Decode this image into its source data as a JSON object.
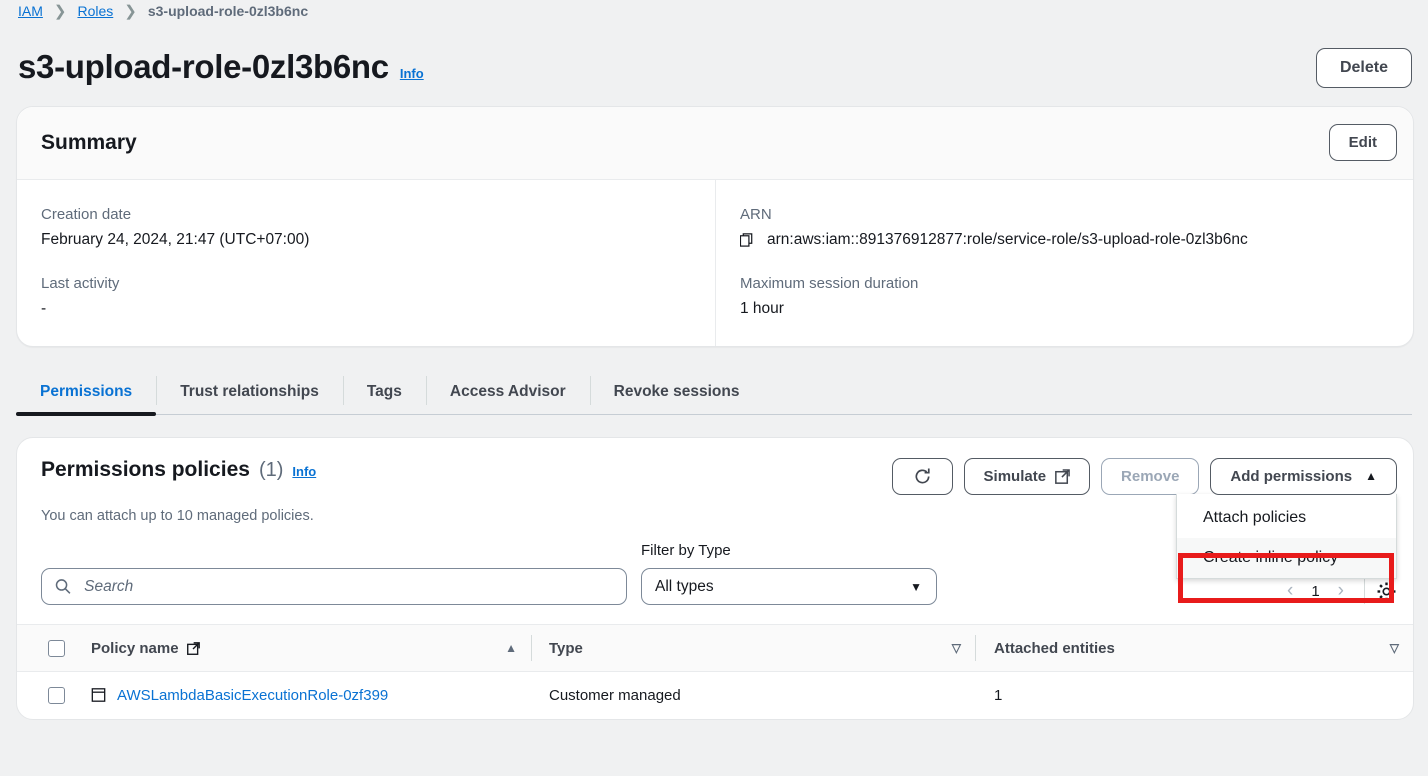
{
  "breadcrumb": {
    "items": [
      {
        "label": "IAM",
        "link": true
      },
      {
        "label": "Roles",
        "link": true
      },
      {
        "label": "s3-upload-role-0zl3b6nc",
        "link": false
      }
    ],
    "separator": "❯"
  },
  "header": {
    "title": "s3-upload-role-0zl3b6nc",
    "info_label": "Info",
    "delete_label": "Delete"
  },
  "summary": {
    "title": "Summary",
    "edit_label": "Edit",
    "creation_date_label": "Creation date",
    "creation_date_value": "February 24, 2024, 21:47 (UTC+07:00)",
    "last_activity_label": "Last activity",
    "last_activity_value": "-",
    "arn_label": "ARN",
    "arn_value": "arn:aws:iam::891376912877:role/service-role/s3-upload-role-0zl3b6nc",
    "copy_icon": "copy-icon",
    "max_session_label": "Maximum session duration",
    "max_session_value": "1 hour"
  },
  "tabs": [
    {
      "label": "Permissions",
      "active": true
    },
    {
      "label": "Trust relationships",
      "active": false
    },
    {
      "label": "Tags",
      "active": false
    },
    {
      "label": "Access Advisor",
      "active": false
    },
    {
      "label": "Revoke sessions",
      "active": false
    }
  ],
  "permissions": {
    "title": "Permissions policies",
    "count": "(1)",
    "info_label": "Info",
    "subtitle": "You can attach up to 10 managed policies.",
    "refresh_icon": "refresh-icon",
    "simulate_label": "Simulate",
    "simulate_icon": "external-link-icon",
    "remove_label": "Remove",
    "remove_disabled": true,
    "add_permissions_label": "Add permissions",
    "add_permissions_caret": "▲",
    "dropdown": {
      "open": true,
      "items": [
        {
          "label": "Attach policies",
          "highlighted": true
        },
        {
          "label": "Create inline policy",
          "highlighted": false
        }
      ]
    }
  },
  "filters": {
    "search_placeholder": "Search",
    "search_value": "",
    "search_icon": "search-icon",
    "filter_type_label": "Filter by Type",
    "filter_type_value": "All types",
    "filter_type_caret": "▼",
    "pagination": {
      "prev": "‹",
      "page": "1",
      "next": "›"
    },
    "settings_icon": "gear-icon"
  },
  "table": {
    "columns": [
      {
        "label": "Policy name",
        "icon": "external-link-icon",
        "sort": "▲"
      },
      {
        "label": "Type",
        "icon": "",
        "sort": "▽"
      },
      {
        "label": "Attached entities",
        "icon": "",
        "sort": "▽"
      }
    ],
    "rows": [
      {
        "policy_name": "AWSLambdaBasicExecutionRole-0zf399",
        "type": "Customer managed",
        "attached_entities": "1"
      }
    ]
  },
  "colors": {
    "accent": "#0972d3",
    "highlight": "#e81b1b",
    "page_bg": "#f0f1f2",
    "muted": "#5f6b7a"
  }
}
